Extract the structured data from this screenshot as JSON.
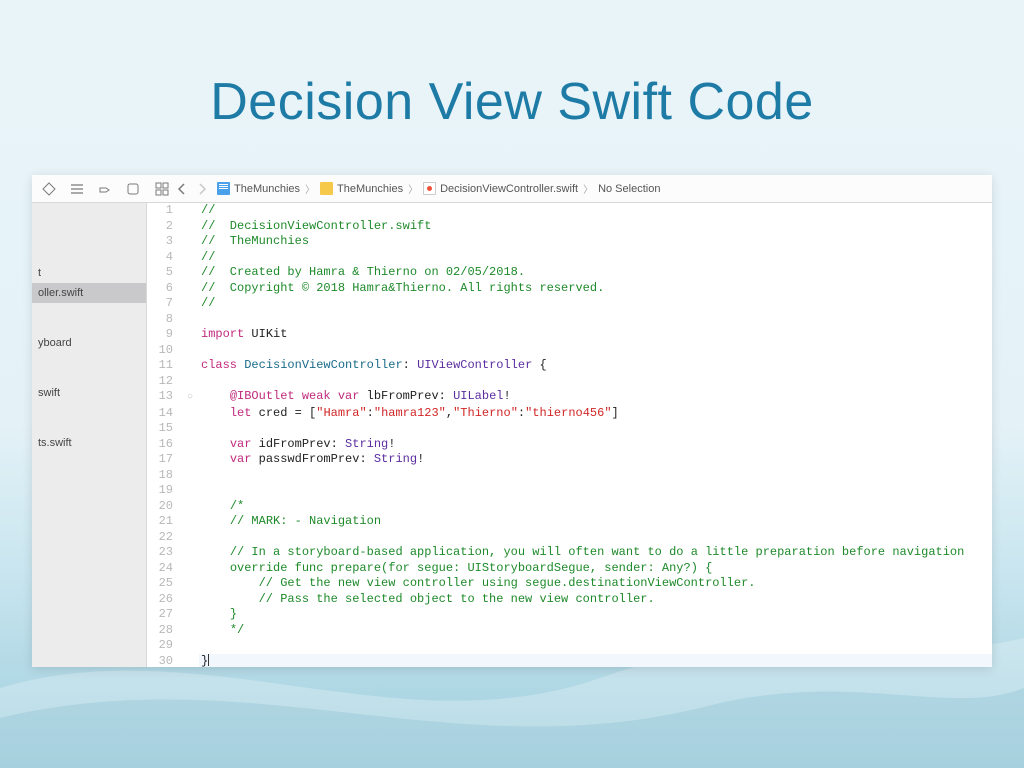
{
  "slide": {
    "title": "Decision View Swift Code"
  },
  "breadcrumb": [
    {
      "label": "TheMunchies",
      "icon": "blue-doc"
    },
    {
      "label": "TheMunchies",
      "icon": "folder"
    },
    {
      "label": "DecisionViewController.swift",
      "icon": "swift-doc"
    },
    {
      "label": "No Selection",
      "icon": ""
    }
  ],
  "sidebar": {
    "items": [
      {
        "label": "t",
        "selected": false
      },
      {
        "label": "oller.swift",
        "selected": true
      },
      {
        "label": "",
        "selected": false
      },
      {
        "label": "yboard",
        "selected": false
      },
      {
        "label": "",
        "selected": false
      },
      {
        "label": "swift",
        "selected": false
      },
      {
        "label": "",
        "selected": false
      },
      {
        "label": "ts.swift",
        "selected": false
      }
    ]
  },
  "code": {
    "lines": [
      {
        "n": 1,
        "icon": "",
        "tokens": [
          [
            "comment",
            "//"
          ]
        ]
      },
      {
        "n": 2,
        "icon": "",
        "tokens": [
          [
            "comment",
            "//  DecisionViewController.swift"
          ]
        ]
      },
      {
        "n": 3,
        "icon": "",
        "tokens": [
          [
            "comment",
            "//  TheMunchies"
          ]
        ]
      },
      {
        "n": 4,
        "icon": "",
        "tokens": [
          [
            "comment",
            "//"
          ]
        ]
      },
      {
        "n": 5,
        "icon": "",
        "tokens": [
          [
            "comment",
            "//  Created by Hamra & Thierno on 02/05/2018."
          ]
        ]
      },
      {
        "n": 6,
        "icon": "",
        "tokens": [
          [
            "comment",
            "//  Copyright © 2018 Hamra&Thierno. All rights reserved."
          ]
        ]
      },
      {
        "n": 7,
        "icon": "",
        "tokens": [
          [
            "comment",
            "//"
          ]
        ]
      },
      {
        "n": 8,
        "icon": "",
        "tokens": [
          [
            "plain",
            ""
          ]
        ]
      },
      {
        "n": 9,
        "icon": "",
        "tokens": [
          [
            "keyword",
            "import"
          ],
          [
            "plain",
            " "
          ],
          [
            "plain",
            "UIKit"
          ]
        ]
      },
      {
        "n": 10,
        "icon": "",
        "tokens": [
          [
            "plain",
            ""
          ]
        ]
      },
      {
        "n": 11,
        "icon": "",
        "tokens": [
          [
            "keyword",
            "class"
          ],
          [
            "plain",
            " "
          ],
          [
            "typedark",
            "DecisionViewController"
          ],
          [
            "plain",
            ": "
          ],
          [
            "type",
            "UIViewController"
          ],
          [
            "plain",
            " {"
          ]
        ]
      },
      {
        "n": 12,
        "icon": "",
        "tokens": [
          [
            "plain",
            ""
          ]
        ]
      },
      {
        "n": 13,
        "icon": "circle",
        "tokens": [
          [
            "plain",
            "    "
          ],
          [
            "keyword",
            "@IBOutlet"
          ],
          [
            "plain",
            " "
          ],
          [
            "keyword",
            "weak"
          ],
          [
            "plain",
            " "
          ],
          [
            "keyword",
            "var"
          ],
          [
            "plain",
            " "
          ],
          [
            "plain",
            "lbFromPrev"
          ],
          [
            "plain",
            ": "
          ],
          [
            "type",
            "UILabel"
          ],
          [
            "plain",
            "!"
          ]
        ]
      },
      {
        "n": 14,
        "icon": "",
        "tokens": [
          [
            "plain",
            "    "
          ],
          [
            "keyword",
            "let"
          ],
          [
            "plain",
            " "
          ],
          [
            "plain",
            "cred"
          ],
          [
            "plain",
            " = ["
          ],
          [
            "string",
            "\"Hamra\""
          ],
          [
            "plain",
            ":"
          ],
          [
            "string",
            "\"hamra123\""
          ],
          [
            "plain",
            ","
          ],
          [
            "string",
            "\"Thierno\""
          ],
          [
            "plain",
            ":"
          ],
          [
            "string",
            "\"thierno456\""
          ],
          [
            "plain",
            "]"
          ]
        ]
      },
      {
        "n": 15,
        "icon": "",
        "tokens": [
          [
            "plain",
            ""
          ]
        ]
      },
      {
        "n": 16,
        "icon": "",
        "tokens": [
          [
            "plain",
            "    "
          ],
          [
            "keyword",
            "var"
          ],
          [
            "plain",
            " "
          ],
          [
            "plain",
            "idFromPrev"
          ],
          [
            "plain",
            ": "
          ],
          [
            "type",
            "String"
          ],
          [
            "plain",
            "!"
          ]
        ]
      },
      {
        "n": 17,
        "icon": "",
        "tokens": [
          [
            "plain",
            "    "
          ],
          [
            "keyword",
            "var"
          ],
          [
            "plain",
            " "
          ],
          [
            "plain",
            "passwdFromPrev"
          ],
          [
            "plain",
            ": "
          ],
          [
            "type",
            "String"
          ],
          [
            "plain",
            "!"
          ]
        ]
      },
      {
        "n": 18,
        "icon": "",
        "tokens": [
          [
            "plain",
            ""
          ]
        ]
      },
      {
        "n": 19,
        "icon": "",
        "tokens": [
          [
            "plain",
            ""
          ]
        ]
      },
      {
        "n": 20,
        "icon": "",
        "tokens": [
          [
            "plain",
            "    "
          ],
          [
            "comment",
            "/*"
          ]
        ]
      },
      {
        "n": 21,
        "icon": "",
        "tokens": [
          [
            "plain",
            "    "
          ],
          [
            "comment",
            "// MARK: - Navigation"
          ]
        ]
      },
      {
        "n": 22,
        "icon": "",
        "tokens": [
          [
            "plain",
            ""
          ]
        ]
      },
      {
        "n": 23,
        "icon": "",
        "tokens": [
          [
            "plain",
            "    "
          ],
          [
            "comment",
            "// In a storyboard-based application, you will often want to do a little preparation before navigation"
          ]
        ]
      },
      {
        "n": 24,
        "icon": "",
        "tokens": [
          [
            "plain",
            "    "
          ],
          [
            "comment",
            "override func prepare(for segue: UIStoryboardSegue, sender: Any?) {"
          ]
        ]
      },
      {
        "n": 25,
        "icon": "",
        "tokens": [
          [
            "plain",
            "        "
          ],
          [
            "comment",
            "// Get the new view controller using segue.destinationViewController."
          ]
        ]
      },
      {
        "n": 26,
        "icon": "",
        "tokens": [
          [
            "plain",
            "        "
          ],
          [
            "comment",
            "// Pass the selected object to the new view controller."
          ]
        ]
      },
      {
        "n": 27,
        "icon": "",
        "tokens": [
          [
            "plain",
            "    "
          ],
          [
            "comment",
            "}"
          ]
        ]
      },
      {
        "n": 28,
        "icon": "",
        "tokens": [
          [
            "plain",
            "    "
          ],
          [
            "comment",
            "*/"
          ]
        ]
      },
      {
        "n": 29,
        "icon": "",
        "tokens": [
          [
            "plain",
            ""
          ]
        ]
      },
      {
        "n": 30,
        "icon": "",
        "cursor": true,
        "tokens": [
          [
            "plain",
            "}"
          ]
        ]
      }
    ]
  }
}
